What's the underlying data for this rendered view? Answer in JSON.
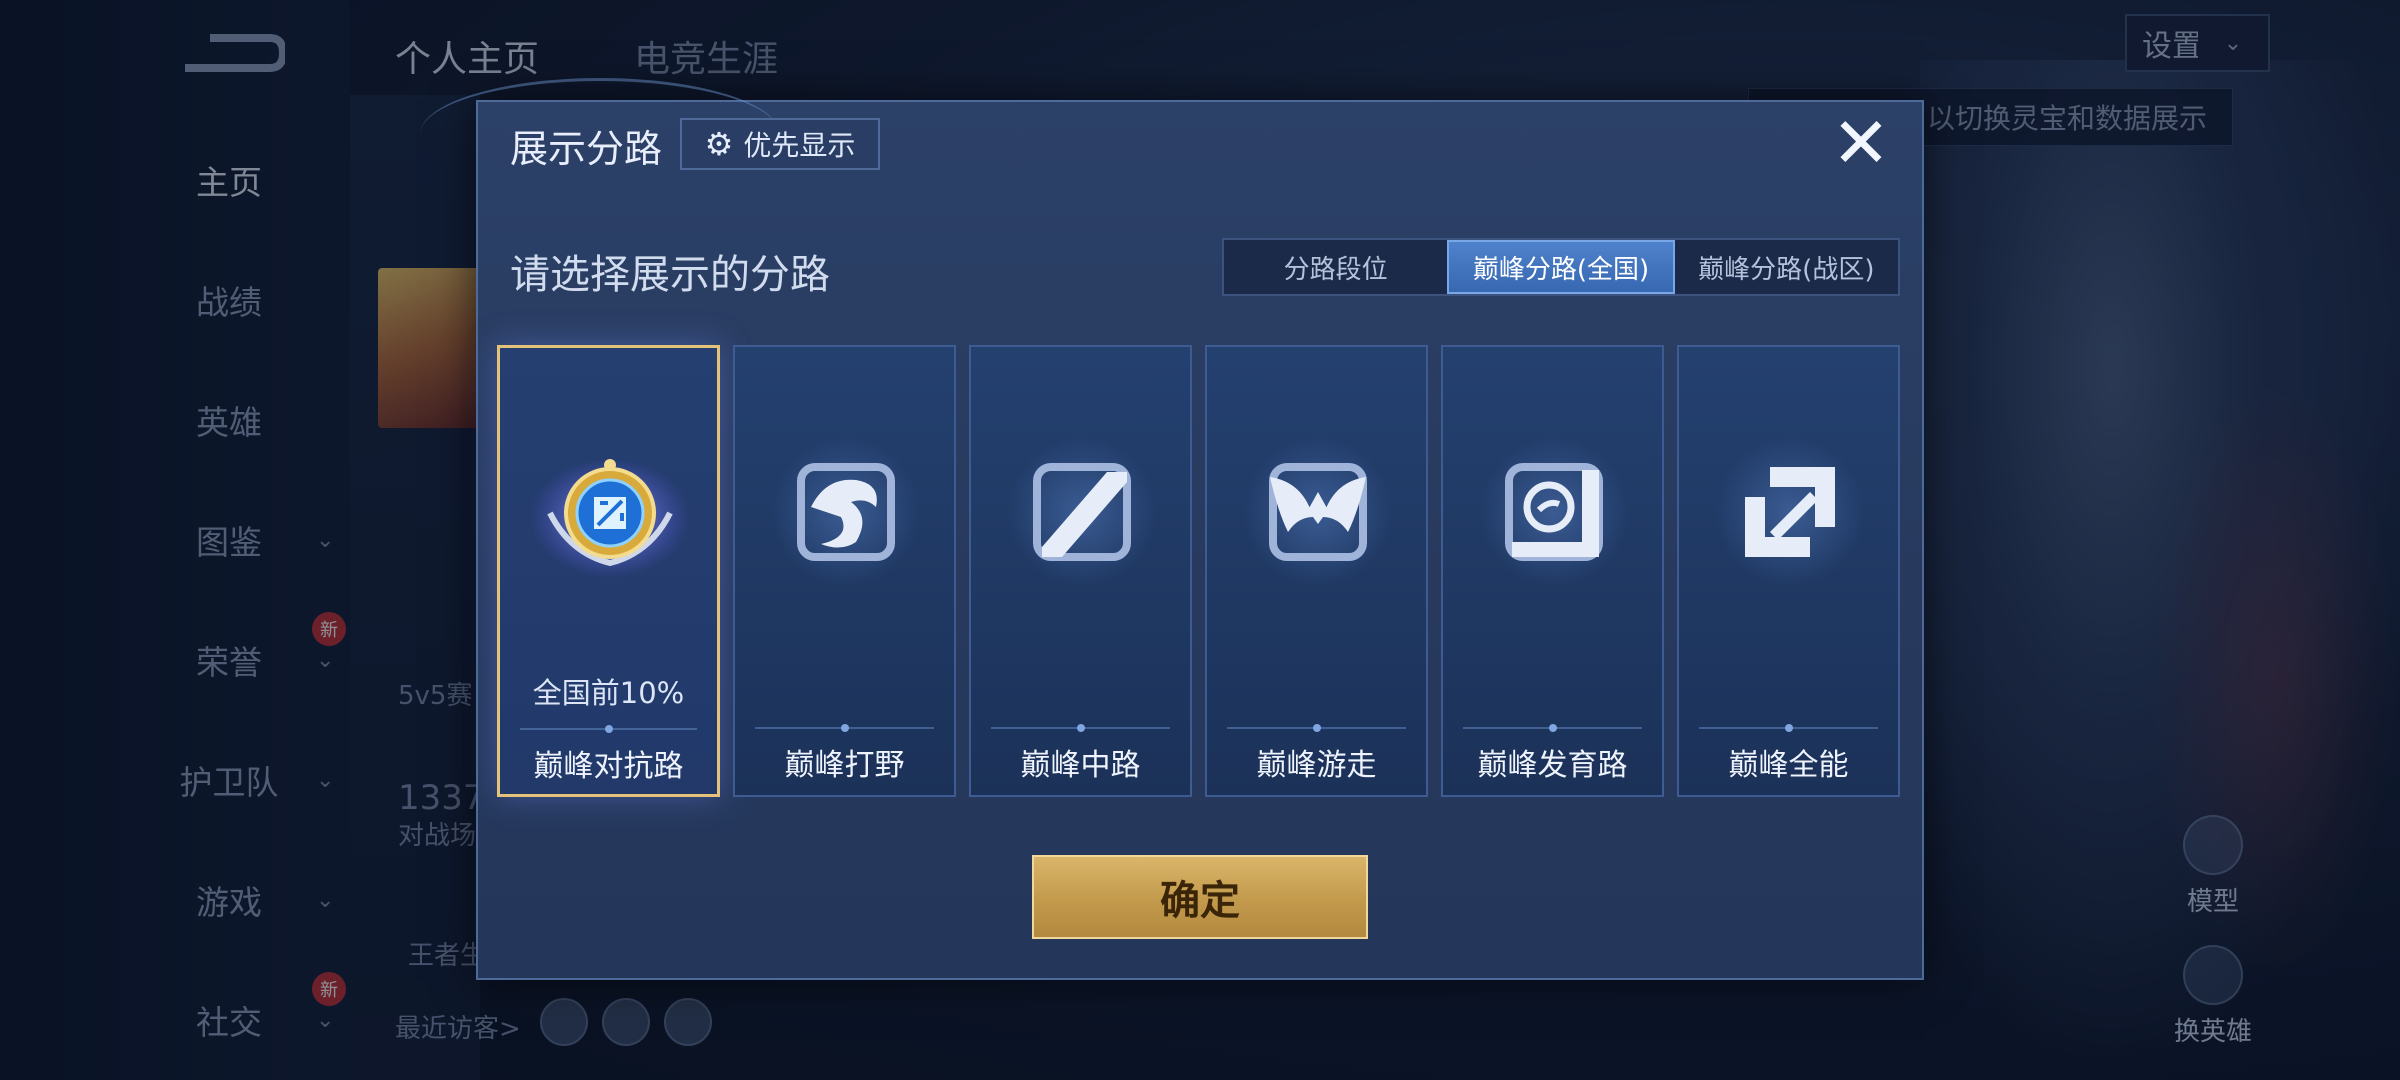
{
  "background": {
    "top_tabs": [
      "个人主页",
      "电竞生涯"
    ],
    "nav": [
      {
        "label": "主页",
        "chevron": false,
        "new": false
      },
      {
        "label": "战绩",
        "chevron": false,
        "new": false
      },
      {
        "label": "英雄",
        "chevron": false,
        "new": false
      },
      {
        "label": "图鉴",
        "chevron": true,
        "new": false
      },
      {
        "label": "荣誉",
        "chevron": true,
        "new": true
      },
      {
        "label": "护卫队",
        "chevron": true,
        "new": false
      },
      {
        "label": "游戏",
        "chevron": true,
        "new": false
      },
      {
        "label": "社交",
        "chevron": true,
        "new": true
      }
    ],
    "new_badge": "新",
    "settings_label": "设置",
    "hint_text": "以切换灵宝和数据展示",
    "mode_text": "5v5赛",
    "count_text": "1337",
    "battle_text": "对战场",
    "king_text": "王者生",
    "recent_visitors": "最近访客>",
    "model_label": "模型",
    "change_hero_label": "换英雄"
  },
  "modal": {
    "title": "展示分路",
    "priority_button": "优先显示",
    "prompt": "请选择展示的分路",
    "segment_tabs": [
      "分路段位",
      "巅峰分路(全国)",
      "巅峰分路(战区)"
    ],
    "selected_segment": 1,
    "roles": [
      {
        "name": "巅峰对抗路",
        "rank": "全国前10%",
        "icon": "clash-lane-emblem",
        "selected": true
      },
      {
        "name": "巅峰打野",
        "rank": "",
        "icon": "jungle-dragon-icon",
        "selected": false
      },
      {
        "name": "巅峰中路",
        "rank": "",
        "icon": "mid-lane-slash-icon",
        "selected": false
      },
      {
        "name": "巅峰游走",
        "rank": "",
        "icon": "roam-wings-icon",
        "selected": false
      },
      {
        "name": "巅峰发育路",
        "rank": "",
        "icon": "farm-lane-icon",
        "selected": false
      },
      {
        "name": "巅峰全能",
        "rank": "",
        "icon": "all-round-icon",
        "selected": false
      }
    ],
    "confirm_button": "确定"
  },
  "colors": {
    "accent_gold": "#d9b56a",
    "segment_selected": "#3f76c2",
    "selected_border": "#e4c27a"
  }
}
